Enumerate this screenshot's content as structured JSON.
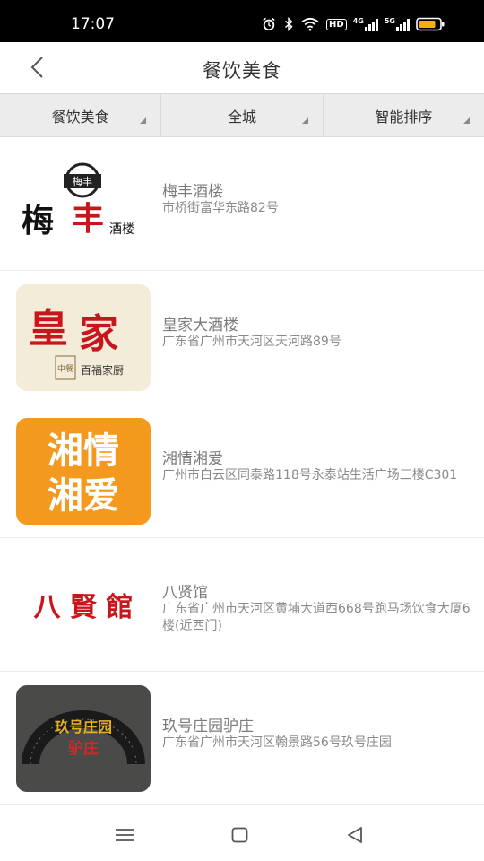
{
  "status_bar": {
    "time": "17:07",
    "icons": [
      "alarm-icon",
      "bluetooth-icon",
      "wifi-icon",
      "hd-icon",
      "signal-4g-icon",
      "signal-5g-icon",
      "battery-icon"
    ],
    "hd_label": "HD",
    "net1_label": "4G",
    "net2_label": "5G",
    "battery_color": "#f0b400"
  },
  "header": {
    "title": "餐饮美食",
    "back_icon": "chevron-left-icon"
  },
  "filters": [
    {
      "label": "餐饮美食"
    },
    {
      "label": "全城"
    },
    {
      "label": "智能排序"
    }
  ],
  "restaurants": [
    {
      "name": "梅丰酒楼",
      "address": "市桥街富华东路82号",
      "logo_text": [
        "梅",
        "丰",
        "酒楼",
        "梅丰"
      ]
    },
    {
      "name": "皇家大酒楼",
      "address": "广东省广州市天河区天河路89号",
      "logo_text": [
        "皇",
        "家",
        "中餐",
        "百福家厨"
      ]
    },
    {
      "name": "湘情湘爱",
      "address": "广州市白云区同泰路118号永泰站生活广场三楼C301",
      "logo_text": [
        "湘情",
        "湘爱"
      ],
      "logo_color": "#f39a1e"
    },
    {
      "name": "八贤馆",
      "address": "广东省广州市天河区黄埔大道西668号跑马场饮食大厦6楼(近西门)",
      "logo_text": [
        "八 賢 館"
      ]
    },
    {
      "name": "玖号庄园驴庄",
      "address": "广东省广州市天河区翰景路56号玖号庄园",
      "logo_text": [
        "玖号庄园",
        "驴庄"
      ]
    }
  ],
  "nav_bar": {
    "icons": [
      "menu-icon",
      "home-icon",
      "back-icon"
    ]
  }
}
